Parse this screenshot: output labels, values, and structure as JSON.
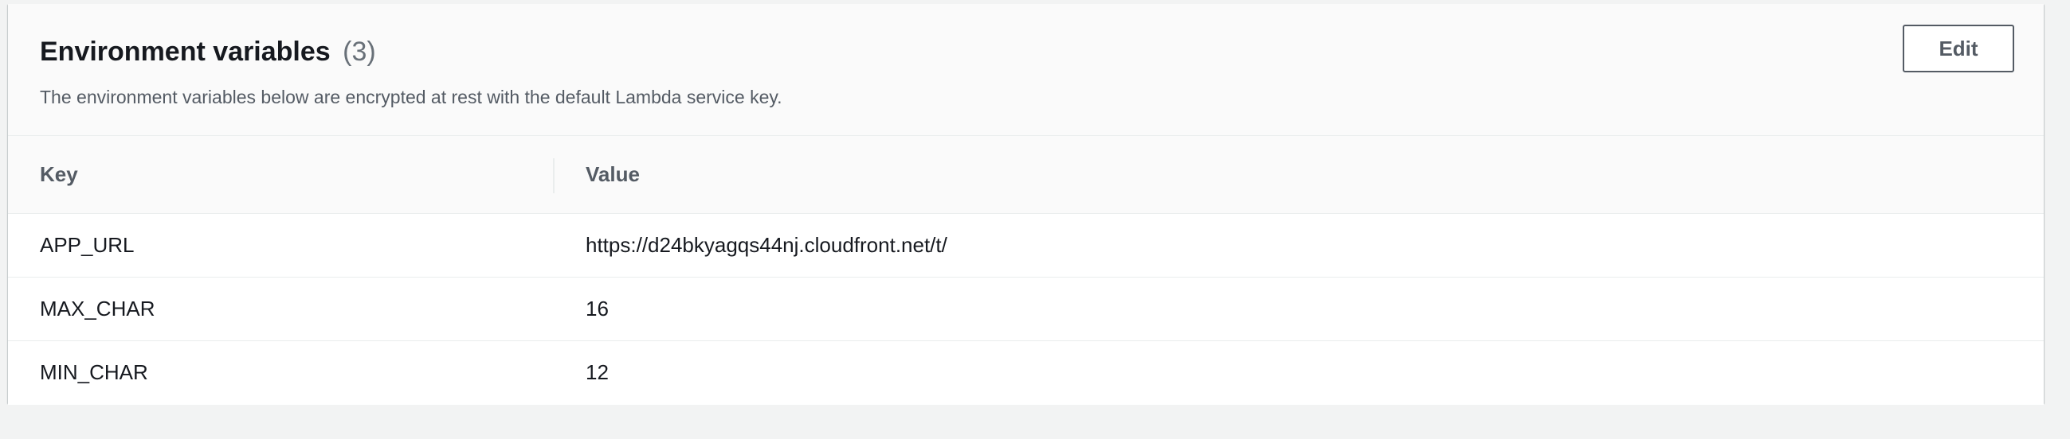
{
  "panel": {
    "title": "Environment variables",
    "count": "(3)",
    "description": "The environment variables below are encrypted at rest with the default Lambda service key.",
    "edit_label": "Edit"
  },
  "table": {
    "columns": [
      "Key",
      "Value"
    ],
    "rows": [
      {
        "key": "APP_URL",
        "value": "https://d24bkyagqs44nj.cloudfront.net/t/"
      },
      {
        "key": "MAX_CHAR",
        "value": "16"
      },
      {
        "key": "MIN_CHAR",
        "value": "12"
      }
    ]
  },
  "colors": {
    "page_background": "#f2f3f3",
    "panel_background": "#ffffff",
    "header_background": "#fafafa",
    "text_primary": "#16191f",
    "text_secondary": "#545b64",
    "count_text": "#687078",
    "divider": "#eaeded"
  }
}
